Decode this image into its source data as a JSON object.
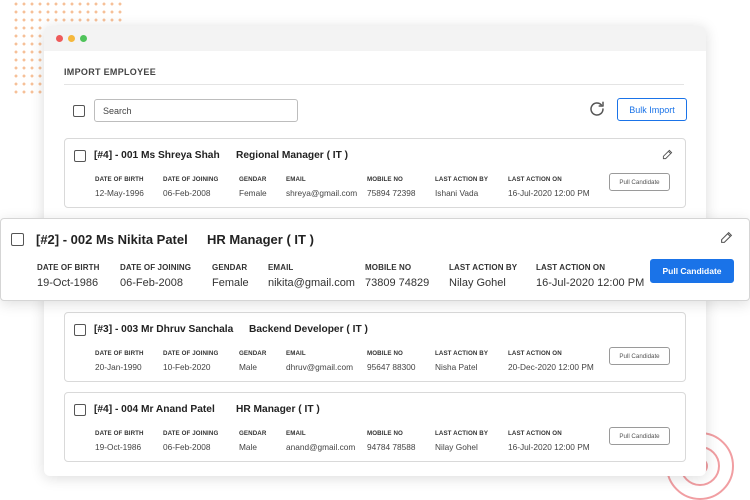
{
  "colors": {
    "accent": "#1a73e8",
    "close_dot": "#ee5b5b",
    "minimize_dot": "#f5b83c",
    "zoom_dot": "#4fc35a",
    "decor_dots": "#f5b98c",
    "decor_rings": "#f19ea2"
  },
  "icons": {
    "refresh": "refresh-icon",
    "edit": "pencil-icon"
  },
  "page": {
    "title": "IMPORT EMPLOYEE",
    "search_placeholder": "Search",
    "bulk_import_label": "Bulk Import"
  },
  "field_labels": {
    "dob": "DATE OF BIRTH",
    "doj": "DATE OF JOINING",
    "gender": "GENDAR",
    "email": "EMAIL",
    "mobile": "MOBILE NO",
    "last_action_by": "LAST ACTION BY",
    "last_action_on": "LAST ACTION ON"
  },
  "employees": [
    {
      "title": "[#4] - 001  Ms Shreya Shah",
      "role": "Regional Manager ( IT )",
      "dob": "12-May-1996",
      "doj": "06-Feb-2008",
      "gender": "Female",
      "email": "shreya@gmail.com",
      "mobile": "75894 72398",
      "last_action_by": "Ishani Vada",
      "last_action_on": "16-Jul-2020 12:00 PM",
      "button_label": "Pull Candidate"
    },
    {
      "title": "[#2] - 002 Ms Nikita Patel",
      "role": "HR Manager ( IT )",
      "dob": "19-Oct-1986",
      "doj": "06-Feb-2008",
      "gender": "Female",
      "email": "nikita@gmail.com",
      "mobile": "73809 74829",
      "last_action_by": "Nilay Gohel",
      "last_action_on": "16-Jul-2020 12:00 PM",
      "button_label": "Pull Candidate"
    },
    {
      "title": "[#3] - 003 Mr Dhruv Sanchala",
      "role": "Backend Developer ( IT )",
      "dob": "20-Jan-1990",
      "doj": "10-Feb-2020",
      "gender": "Male",
      "email": "dhruv@gmail.com",
      "mobile": "95647 88300",
      "last_action_by": "Nisha Patel",
      "last_action_on": "20-Dec-2020 12:00 PM",
      "button_label": "Pull Candidate"
    },
    {
      "title": "[#4] - 004 Mr Anand Patel",
      "role": "HR Manager ( IT )",
      "dob": "19-Oct-1986",
      "doj": "06-Feb-2008",
      "gender": "Male",
      "email": "anand@gmail.com",
      "mobile": "94784 78588",
      "last_action_by": "Nilay Gohel",
      "last_action_on": "16-Jul-2020 12:00 PM",
      "button_label": "Pull Candidate"
    }
  ]
}
